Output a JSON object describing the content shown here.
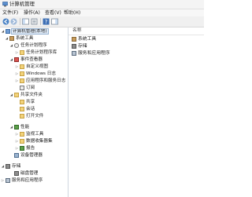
{
  "window": {
    "title": "计算机管理"
  },
  "menu": [
    "文件(F)",
    "操作(A)",
    "查看(V)",
    "帮助(H)"
  ],
  "tree": [
    {
      "label": "计算机管理(本地)",
      "selected": true
    },
    {
      "label": "系统工具"
    },
    {
      "label": "任务计划程序"
    },
    {
      "label": "任务计划程序库"
    },
    {
      "label": "事件查看器"
    },
    {
      "label": "自定义视图"
    },
    {
      "label": "Windows 日志"
    },
    {
      "label": "应用程序和服务日志"
    },
    {
      "label": "订阅"
    },
    {
      "label": "共享文件夹"
    },
    {
      "label": "共享"
    },
    {
      "label": "会话"
    },
    {
      "label": "打开文件"
    },
    {
      "label": "性能"
    },
    {
      "label": "监视工具"
    },
    {
      "label": "数据收集器集"
    },
    {
      "label": "报告"
    },
    {
      "label": "设备管理器"
    },
    {
      "label": "存储"
    },
    {
      "label": "磁盘管理"
    },
    {
      "label": "服务和应用程序"
    }
  ],
  "content": {
    "column_header": "名称",
    "items": [
      "系统工具",
      "存储",
      "服务和应用程序"
    ]
  }
}
